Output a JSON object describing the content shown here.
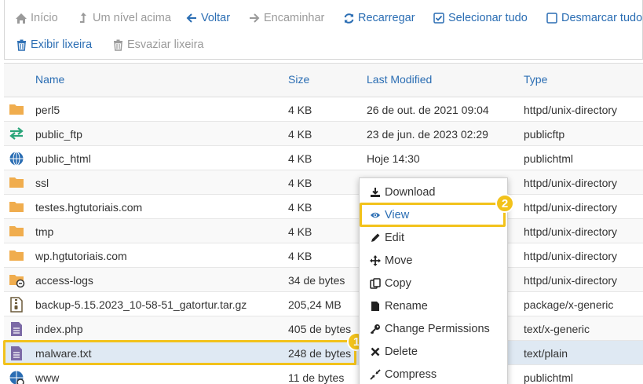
{
  "toolbar": {
    "home": "Início",
    "up": "Um nível acima",
    "back": "Voltar",
    "forward": "Encaminhar",
    "reload": "Recarregar",
    "select_all": "Selecionar tudo",
    "unselect_all": "Desmarcar tudo",
    "view_trash": "Exibir lixeira",
    "empty_trash": "Esvaziar lixeira"
  },
  "table": {
    "headers": {
      "name": "Name",
      "size": "Size",
      "modified": "Last Modified",
      "type": "Type"
    },
    "rows": [
      {
        "icon": "folder-icon",
        "name": "perl5",
        "size": "4 KB",
        "modified": "26 de out. de 2021 09:04",
        "type": "httpd/unix-directory"
      },
      {
        "icon": "ftp-icon",
        "name": "public_ftp",
        "size": "4 KB",
        "modified": "23 de jun. de 2023 02:29",
        "type": "publicftp"
      },
      {
        "icon": "globe-icon",
        "name": "public_html",
        "size": "4 KB",
        "modified": "Hoje 14:30",
        "type": "publichtml"
      },
      {
        "icon": "folder-icon",
        "name": "ssl",
        "size": "4 KB",
        "modified": "",
        "type": "httpd/unix-directory"
      },
      {
        "icon": "folder-icon",
        "name": "testes.hgtutoriais.com",
        "size": "4 KB",
        "modified": "",
        "type": "httpd/unix-directory"
      },
      {
        "icon": "folder-icon",
        "name": "tmp",
        "size": "4 KB",
        "modified": "",
        "type": "httpd/unix-directory"
      },
      {
        "icon": "folder-icon",
        "name": "wp.hgtutoriais.com",
        "size": "4 KB",
        "modified": "",
        "type": "httpd/unix-directory"
      },
      {
        "icon": "folder-link-icon",
        "name": "access-logs",
        "size": "34 de bytes",
        "modified": "",
        "type": "httpd/unix-directory"
      },
      {
        "icon": "archive-icon",
        "name": "backup-5.15.2023_10-58-51_gatortur.tar.gz",
        "size": "205,24 MB",
        "modified": "",
        "type": "package/x-generic"
      },
      {
        "icon": "file-icon",
        "name": "index.php",
        "size": "405 de bytes",
        "modified": "",
        "type": "text/x-generic"
      },
      {
        "icon": "file-icon",
        "name": "malware.txt",
        "size": "248 de bytes",
        "modified": "",
        "type": "text/plain"
      },
      {
        "icon": "globe-link-icon",
        "name": "www",
        "size": "11 de bytes",
        "modified": "",
        "type": "publichtml"
      }
    ]
  },
  "context_menu": {
    "items": [
      {
        "icon": "download-icon",
        "label": "Download"
      },
      {
        "icon": "eye-icon",
        "label": "View"
      },
      {
        "icon": "pencil-icon",
        "label": "Edit"
      },
      {
        "icon": "move-icon",
        "label": "Move"
      },
      {
        "icon": "copy-icon",
        "label": "Copy"
      },
      {
        "icon": "rename-icon",
        "label": "Rename"
      },
      {
        "icon": "key-icon",
        "label": "Change Permissions"
      },
      {
        "icon": "delete-icon",
        "label": "Delete"
      },
      {
        "icon": "compress-icon",
        "label": "Compress"
      }
    ]
  },
  "annotations": {
    "step1": "1",
    "step2": "2"
  },
  "colors": {
    "link_blue": "#2a6db3",
    "folder_orange": "#f0ad4e",
    "highlight_yellow": "#f2c21b",
    "selected_row": "#dfe9f3"
  }
}
